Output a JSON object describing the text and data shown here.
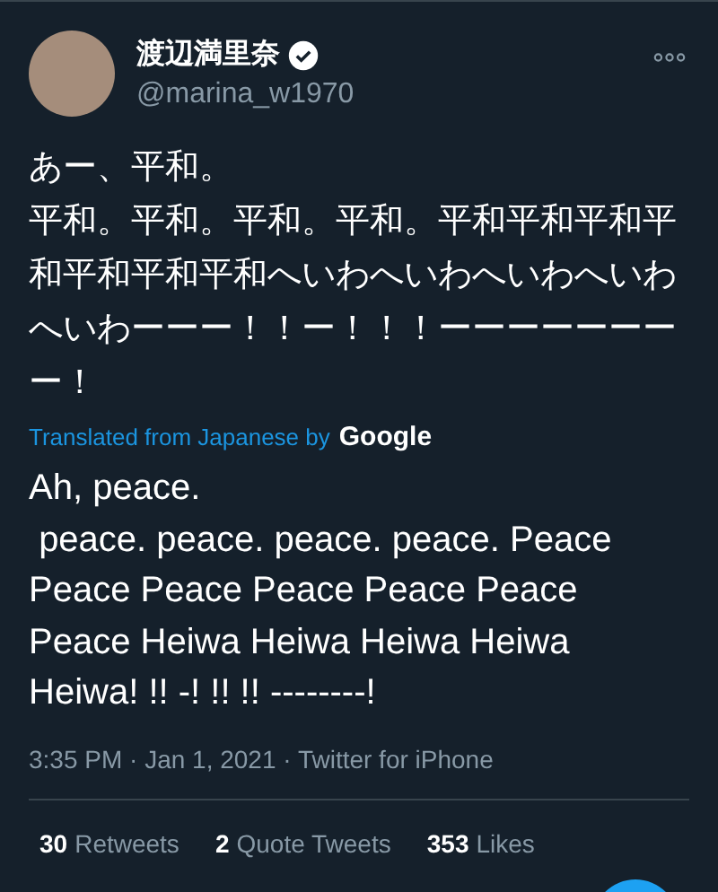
{
  "author": {
    "name": "渡辺満里奈",
    "verified": true,
    "handle": "@marina_w1970"
  },
  "tweet": {
    "lines": [
      "あー、平和。",
      "平和。平和。平和。平和。平和平和平和平和平和平和平和へいわへいわへいわへいわへいわーーー！！ー！！！ーーーーーーーー！"
    ],
    "translation_note": "Translated from Japanese by",
    "translator": "Google",
    "translation": "Ah, peace.\n peace. peace. peace. peace. Peace Peace Peace Peace Peace Peace Peace Heiwa Heiwa Heiwa Heiwa Heiwa! !! -! !! !! --------!",
    "meta": "3:35 PM · Jan 1, 2021 · Twitter for iPhone"
  },
  "stats": [
    {
      "count": "30",
      "label": "Retweets"
    },
    {
      "count": "2",
      "label": "Quote Tweets"
    },
    {
      "count": "353",
      "label": "Likes"
    }
  ]
}
